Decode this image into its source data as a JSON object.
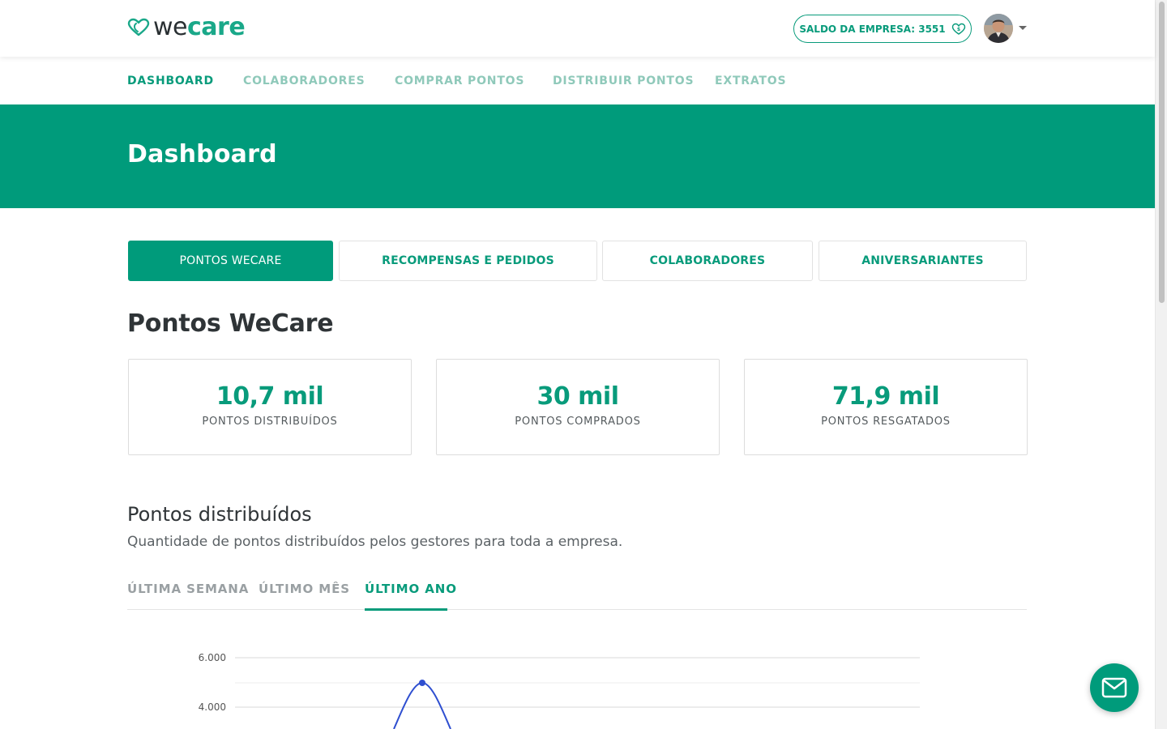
{
  "brand": {
    "logo_we": "we",
    "logo_care": "care",
    "accent": "#009b7b",
    "accent_text": "#089b7b"
  },
  "header": {
    "balance_label": "SALDO DA EMPRESA: 3551",
    "balance_icon": "heart-coin-icon",
    "avatar_icon": "user-avatar",
    "menu_icon": "caret-down-icon"
  },
  "nav": {
    "items": [
      {
        "label": "DASHBOARD",
        "active": true
      },
      {
        "label": "COLABORADORES",
        "active": false
      },
      {
        "label": "COMPRAR PONTOS",
        "active": false
      },
      {
        "label": "DISTRIBUIR PONTOS",
        "active": false
      },
      {
        "label": "EXTRATOS",
        "active": false
      }
    ]
  },
  "page": {
    "title": "Dashboard"
  },
  "dashboard_tabs": [
    {
      "label": "PONTOS WECARE",
      "active": true
    },
    {
      "label": "RECOMPENSAS E PEDIDOS",
      "active": false
    },
    {
      "label": "COLABORADORES",
      "active": false
    },
    {
      "label": "ANIVERSARIANTES",
      "active": false
    }
  ],
  "section": {
    "title": "Pontos WeCare"
  },
  "stats": [
    {
      "value": "10,7 mil",
      "label": "PONTOS DISTRIBUÍDOS"
    },
    {
      "value": "30 mil",
      "label": "PONTOS COMPRADOS"
    },
    {
      "value": "71,9 mil",
      "label": "PONTOS RESGATADOS"
    }
  ],
  "distributed": {
    "title": "Pontos distribuídos",
    "subtitle": "Quantidade de pontos distribuídos pelos gestores para toda a empresa.",
    "periods": [
      {
        "label": "ÚLTIMA SEMANA",
        "active": false
      },
      {
        "label": "ÚLTIMO MÊS",
        "active": false
      },
      {
        "label": "ÚLTIMO ANO",
        "active": true
      }
    ]
  },
  "chart_data": {
    "type": "line",
    "y_ticks": [
      "6.000",
      "4.000"
    ],
    "y_visible_range": [
      3500,
      6000
    ],
    "grid": true,
    "series": [
      {
        "color": "#2f4fd0",
        "peak_value": 5000
      }
    ]
  },
  "fab": {
    "icon": "mail-icon"
  },
  "scrollbar": {
    "position_fraction": 0.0
  }
}
